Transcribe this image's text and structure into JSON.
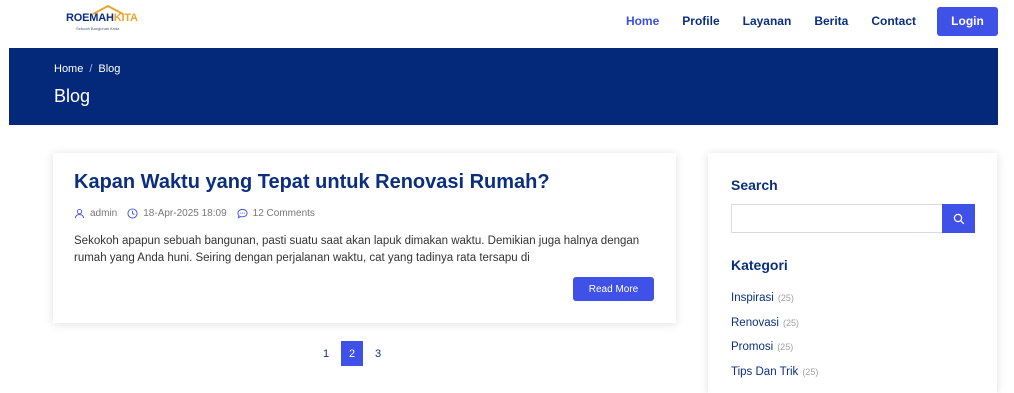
{
  "header": {
    "logo": {
      "word_a": "ROEMAH",
      "word_b": "KITA",
      "tagline": "Sebuah Bangunan Anda"
    },
    "nav": [
      {
        "label": "Home",
        "active": true
      },
      {
        "label": "Profile",
        "active": false
      },
      {
        "label": "Layanan",
        "active": false
      },
      {
        "label": "Berita",
        "active": false
      },
      {
        "label": "Contact",
        "active": false
      }
    ],
    "login_label": "Login"
  },
  "banner": {
    "breadcrumb": [
      "Home",
      "Blog"
    ],
    "breadcrumb_sep": "/",
    "title": "Blog"
  },
  "post": {
    "title": "Kapan Waktu yang Tepat untuk Renovasi Rumah?",
    "author": "admin",
    "date": "18-Apr-2025 18:09",
    "comments": "12 Comments",
    "excerpt": "Sekokoh apapun sebuah bangunan, pasti suatu saat akan lapuk dimakan waktu. Demikian juga halnya dengan rumah yang Anda huni. Seiring dengan perjalanan waktu, cat yang tadinya rata tersapu di",
    "read_more": "Read More"
  },
  "pagination": {
    "pages": [
      "1",
      "2",
      "3"
    ],
    "active": "2"
  },
  "sidebar": {
    "search_title": "Search",
    "search_value": "",
    "category_title": "Kategori",
    "categories": [
      {
        "name": "Inspirasi",
        "count": "(25)"
      },
      {
        "name": "Renovasi",
        "count": "(25)"
      },
      {
        "name": "Promosi",
        "count": "(25)"
      },
      {
        "name": "Tips Dan Trik",
        "count": "(25)"
      }
    ]
  },
  "colors": {
    "brand_navy": "#04297a",
    "accent_blue": "#3f51e6",
    "logo_orange": "#f0a32c"
  }
}
